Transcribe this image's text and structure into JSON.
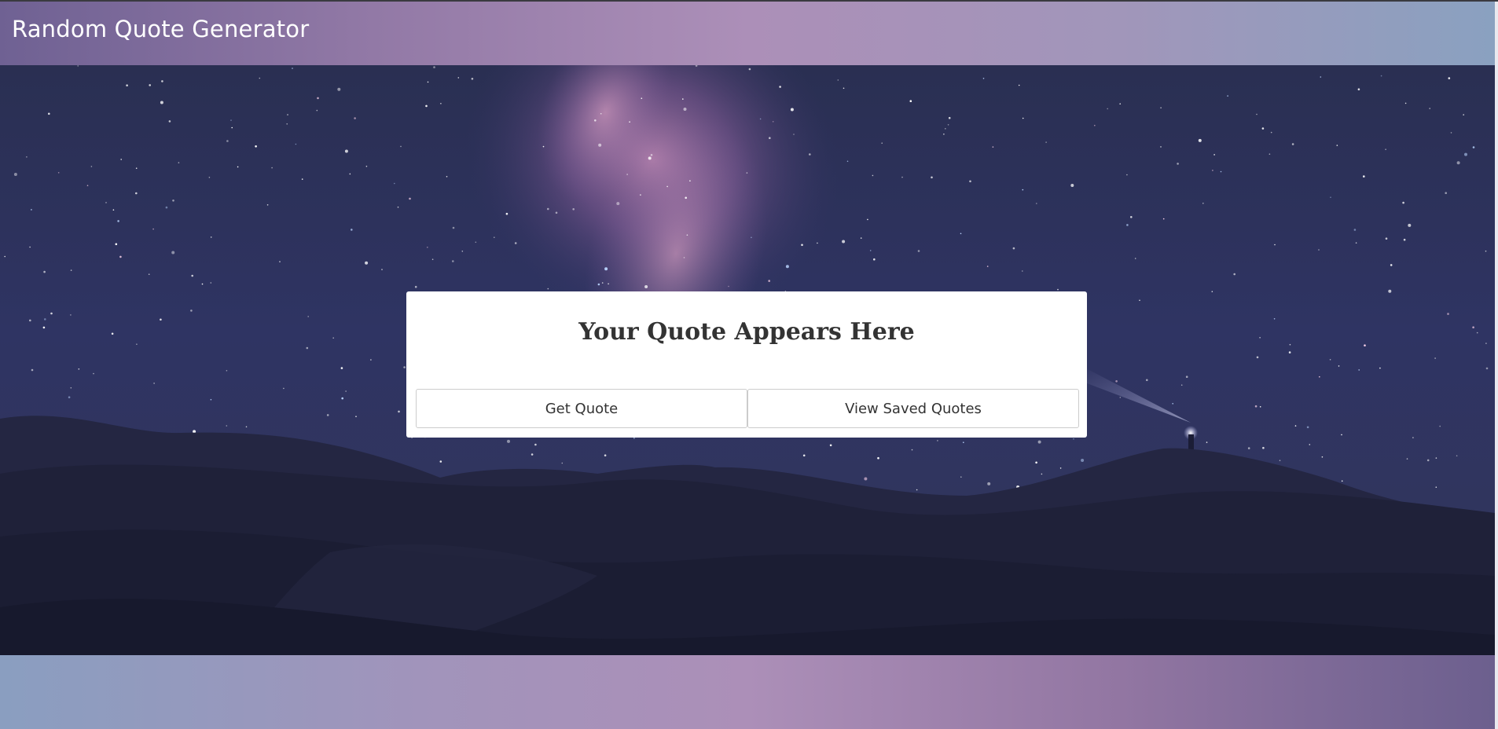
{
  "header": {
    "title": "Random Quote Generator"
  },
  "quote_card": {
    "quote_text": "Your Quote Appears Here",
    "get_quote_label": "Get Quote",
    "view_saved_label": "View Saved Quotes"
  },
  "colors": {
    "header_gradient": [
      "#6f6193",
      "#ac8fb8",
      "#8aa1c0"
    ],
    "footer_gradient": [
      "#8a9ec0",
      "#ac8fb8",
      "#6c5f8e"
    ],
    "card_background": "#ffffff",
    "quote_text": "#333333"
  },
  "background_image": "night-sky-milky-way-over-desert-dunes"
}
